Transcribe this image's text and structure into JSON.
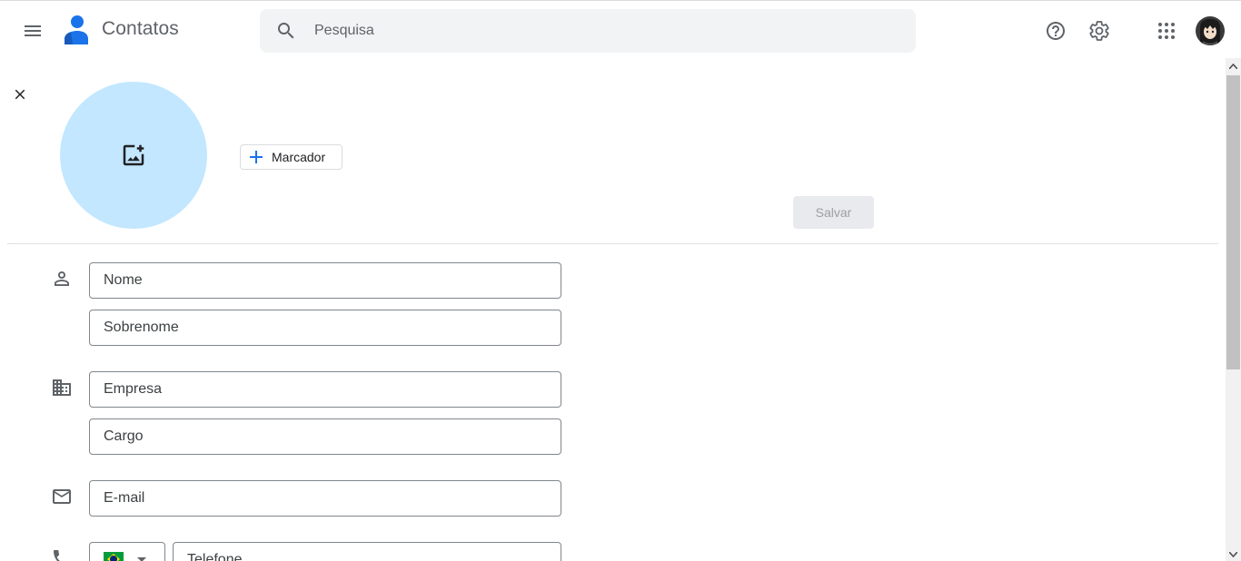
{
  "app": {
    "title": "Contatos"
  },
  "header": {
    "search_placeholder": "Pesquisa",
    "icons": [
      "menu-icon",
      "search-icon",
      "help-icon",
      "settings-icon",
      "apps-icon",
      "avatar"
    ]
  },
  "editor": {
    "label_button": "Marcador",
    "save_button": "Salvar"
  },
  "form": {
    "first_name_placeholder": "Nome",
    "last_name_placeholder": "Sobrenome",
    "company_placeholder": "Empresa",
    "job_title_placeholder": "Cargo",
    "email_placeholder": "E-mail",
    "phone_placeholder": "Telefone",
    "country": "Brasil"
  },
  "colors": {
    "accent": "#1a73e8",
    "photo_bg": "#c2e7ff",
    "search_bg": "#f1f3f4",
    "save_disabled_bg": "#e8eaed"
  }
}
